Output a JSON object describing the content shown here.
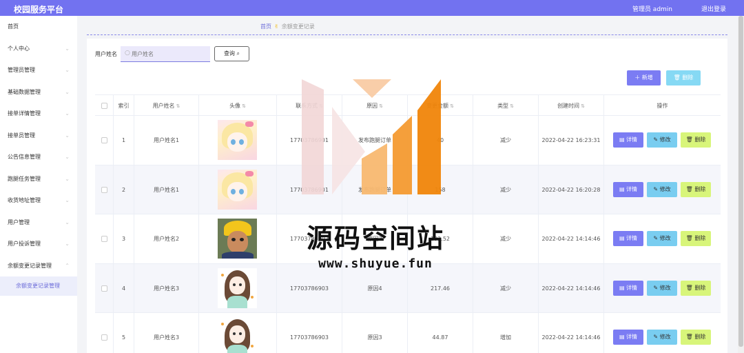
{
  "header": {
    "brand": "校园服务平台",
    "user": "管理员 admin",
    "logout": "退出登录"
  },
  "sidebar": {
    "items": [
      {
        "label": "首页",
        "chevron": false
      },
      {
        "label": "个人中心",
        "chevron": true
      },
      {
        "label": "管理员管理",
        "chevron": true
      },
      {
        "label": "基础数据管理",
        "chevron": true
      },
      {
        "label": "接单详情管理",
        "chevron": true
      },
      {
        "label": "接单员管理",
        "chevron": true
      },
      {
        "label": "公告信息管理",
        "chevron": true
      },
      {
        "label": "跑腿任务管理",
        "chevron": true
      },
      {
        "label": "收货地址管理",
        "chevron": true
      },
      {
        "label": "用户管理",
        "chevron": true
      },
      {
        "label": "用户投诉管理",
        "chevron": true
      },
      {
        "label": "余额变更记录管理",
        "chevron": true,
        "expanded": true
      }
    ],
    "subitem": "余额变更记录管理"
  },
  "breadcrumb": {
    "home": "首页",
    "separator": "✌",
    "current": "余额变更记录"
  },
  "search": {
    "label": "用户姓名",
    "placeholder": "用户姓名",
    "value": "",
    "button": "查询"
  },
  "toolbar": {
    "add": "新增",
    "delete": "删除"
  },
  "table": {
    "headers": {
      "index": "索引",
      "name": "用户姓名",
      "avatar": "头像",
      "phone": "联系方式",
      "reason": "原因",
      "amount": "变更金额",
      "type": "类型",
      "created": "创建时间",
      "actions": "操作"
    },
    "rows": [
      {
        "index": "1",
        "name": "用户姓名1",
        "avatar": "anime-girl",
        "phone": "17703786901",
        "reason": "发布跑腿订单",
        "amount": "40",
        "type": "减少",
        "created": "2022-04-22 16:23:31"
      },
      {
        "index": "2",
        "name": "用户姓名1",
        "avatar": "anime-girl",
        "phone": "17703786901",
        "reason": "发布跑腿订单",
        "amount": "158",
        "type": "减少",
        "created": "2022-04-22 16:20:28"
      },
      {
        "index": "3",
        "name": "用户姓名2",
        "avatar": "boy-yellow-hat",
        "phone": "17703786902",
        "reason": "原因3",
        "amount": "192.52",
        "type": "减少",
        "created": "2022-04-22 14:14:46"
      },
      {
        "index": "4",
        "name": "用户姓名3",
        "avatar": "girl-cartoon",
        "phone": "17703786903",
        "reason": "原因4",
        "amount": "217.46",
        "type": "减少",
        "created": "2022-04-22 14:14:46"
      },
      {
        "index": "5",
        "name": "用户姓名3",
        "avatar": "girl-cartoon",
        "phone": "17703786903",
        "reason": "原因3",
        "amount": "44.87",
        "type": "增加",
        "created": "2022-04-22 14:14:46"
      }
    ],
    "actions": {
      "detail": "详情",
      "edit": "修改",
      "remove": "删除"
    }
  },
  "watermark": {
    "text": "源码空间站",
    "url": "www.shuyue.fun"
  },
  "colors": {
    "primary": "#7272f0",
    "edit": "#79cdf0",
    "remove": "#d8f57a",
    "watermark_orange": "#f0850a"
  }
}
